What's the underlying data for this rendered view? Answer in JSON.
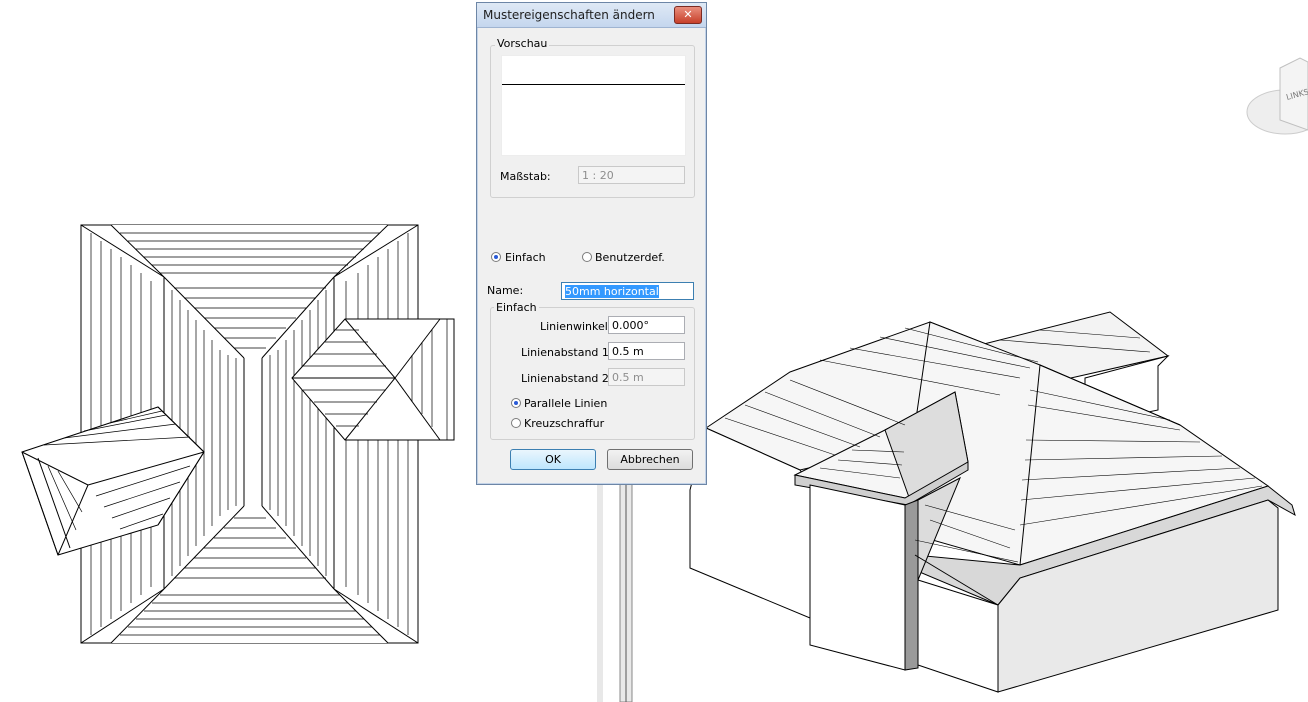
{
  "dialog": {
    "title": "Mustereigenschaften ändern",
    "close_glyph": "✕",
    "preview_group_label": "Vorschau",
    "scale_label": "Maßstab:",
    "scale_value": "1 : 20",
    "type_simple_label": "Einfach",
    "type_custom_label": "Benutzerdef.",
    "type_selected": "Einfach",
    "name_label": "Name:",
    "name_value": "50mm horizontal",
    "simple_group_label": "Einfach",
    "angle_label": "Linienwinkel:",
    "angle_value": "0.000°",
    "spacing1_label": "Linienabstand 1:",
    "spacing1_value": "0.5 m",
    "spacing2_label": "Linienabstand 2:",
    "spacing2_value": "0.5 m",
    "parallel_label": "Parallele Linien",
    "crosshatch_label": "Kreuzschraffur",
    "line_mode_selected": "Parallele Linien",
    "ok_label": "OK",
    "cancel_label": "Abbrechen"
  },
  "viewcube": {
    "face_label": "LINKS"
  },
  "colors": {
    "titlebar": "#c4d6ee",
    "roof_face": "#f6f6f6",
    "wall_face": "#ffffff",
    "shadow_face": "#dcdcdc"
  }
}
